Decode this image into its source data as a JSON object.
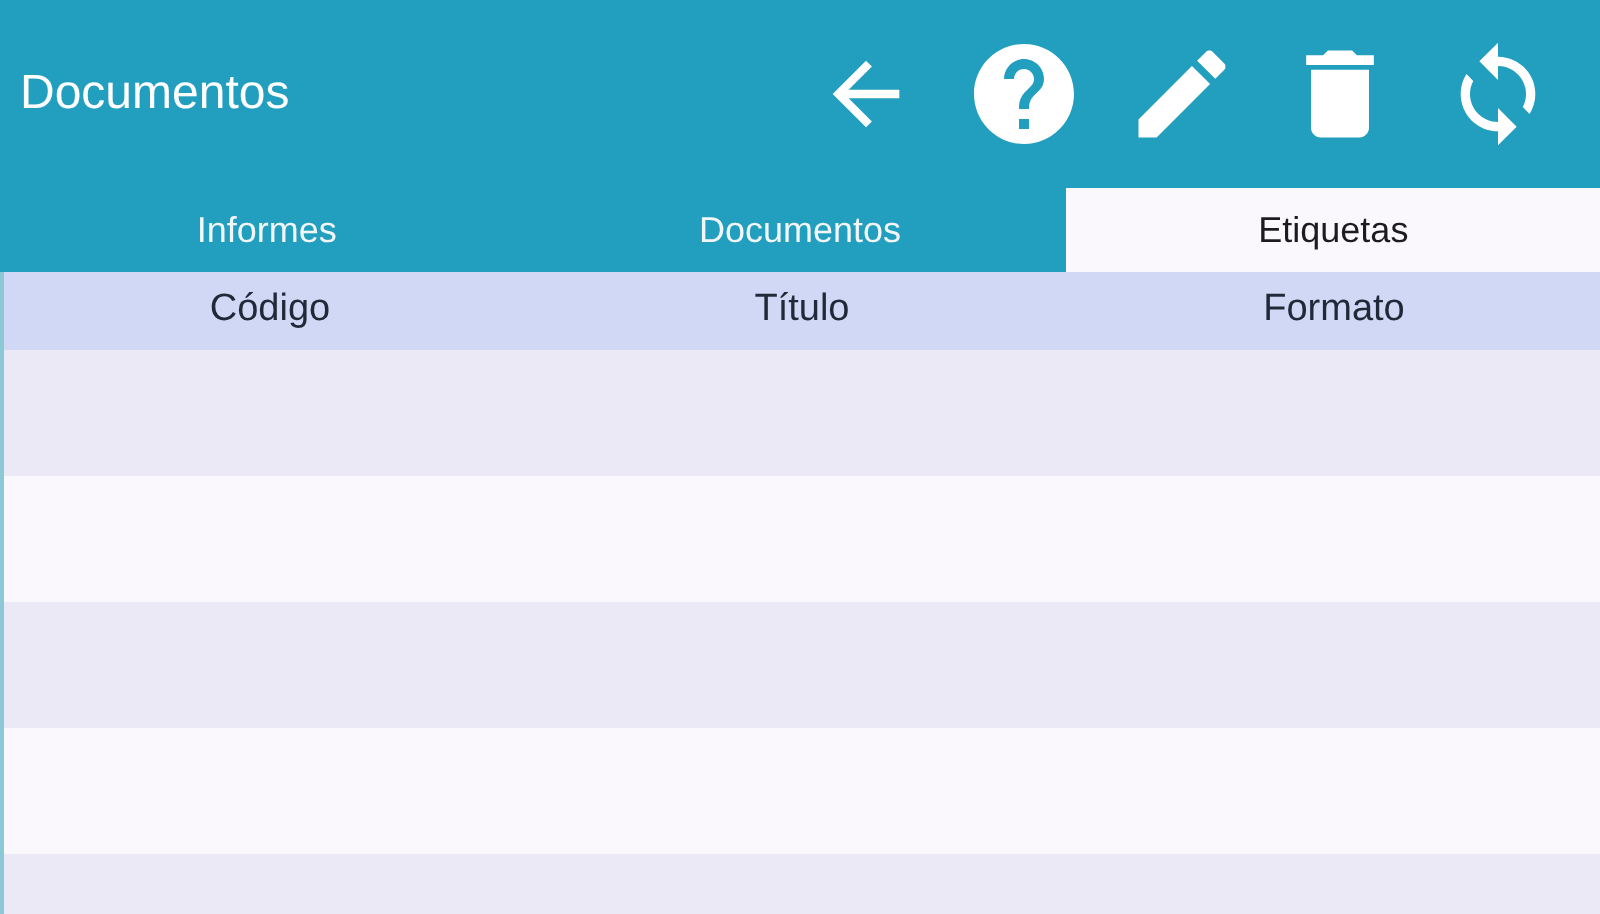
{
  "app_bar": {
    "title": "Documentos"
  },
  "tabs": [
    {
      "label": "Informes",
      "selected": false
    },
    {
      "label": "Documentos",
      "selected": false
    },
    {
      "label": "Etiquetas",
      "selected": true
    }
  ],
  "table": {
    "columns": [
      "Código",
      "Título",
      "Formato"
    ]
  }
}
